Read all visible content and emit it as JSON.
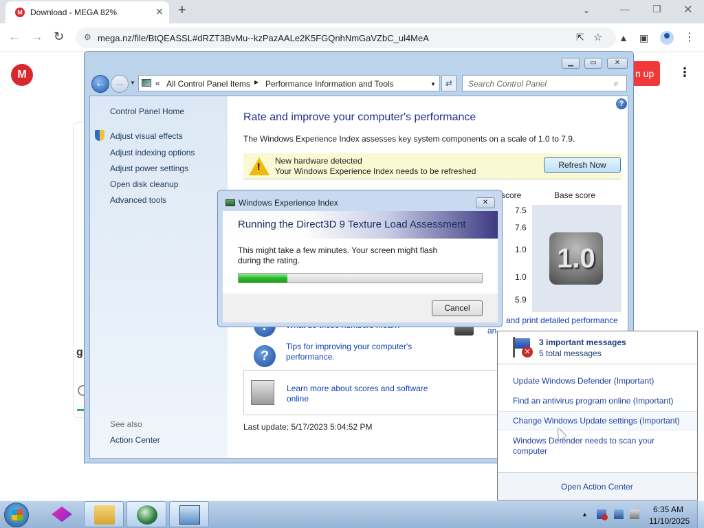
{
  "browser": {
    "tab_title": "Download - MEGA 82%",
    "tab_favicon": "M",
    "url": "mega.nz/file/BtQEASSL#dRZT3BvMu--kzPazAALe2K5FGQnhNmGaVZbC_ul4MeA"
  },
  "mega": {
    "logo": "M",
    "signup_label": "n up",
    "card_letter": "g"
  },
  "control_panel": {
    "breadcrumb_1": "All Control Panel Items",
    "breadcrumb_2": "Performance Information and Tools",
    "search_placeholder": "Search Control Panel",
    "sidebar": {
      "home": "Control Panel Home",
      "links": [
        "Adjust visual effects",
        "Adjust indexing options",
        "Adjust power settings",
        "Open disk cleanup",
        "Advanced tools"
      ],
      "see_also": "See also",
      "action_center": "Action Center"
    },
    "heading": "Rate and improve your computer's performance",
    "description": "The Windows Experience Index assesses key system components on a scale of 1.0 to 7.9.",
    "alert": {
      "line1": "New hardware detected",
      "line2": "Your Windows Experience Index needs to be refreshed",
      "button": "Refresh Now"
    },
    "columns": {
      "subscore": "score",
      "base": "Base score"
    },
    "subscores": [
      "7.5",
      "7.6",
      "1.0",
      "1.0",
      "5.9"
    ],
    "base_score": "1.0",
    "links": {
      "print": "and print detailed performance",
      "print_cont": "an",
      "numbers": "What do these numbers mean?",
      "tips_line1": "Tips for improving your computer's",
      "tips_line2": "performance.",
      "learn_line1": "Learn more about scores and software",
      "learn_line2": "online"
    },
    "last_update": "Last update: 5/17/2023 5:04:52 PM"
  },
  "wei_dialog": {
    "title": "Windows Experience Index",
    "heading": "Running the Direct3D 9 Texture Load Assessment",
    "message": "This might take a few minutes. Your screen might flash during the rating.",
    "progress": 0.2,
    "cancel": "Cancel"
  },
  "action_center": {
    "headline": "3 important messages",
    "subline": "5 total messages",
    "items": [
      "Update Windows Defender (Important)",
      "Find an antivirus program online (Important)",
      "Change Windows Update settings (Important)",
      "Windows Defender needs to scan your",
      "computer"
    ],
    "open": "Open Action Center"
  },
  "taskbar": {
    "time": "6:35 AM",
    "date": "11/10/2025"
  }
}
